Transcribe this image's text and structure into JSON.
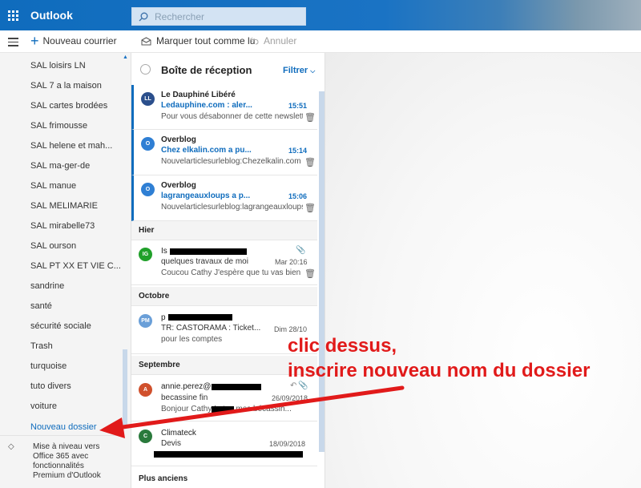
{
  "app": {
    "title": "Outlook"
  },
  "search": {
    "placeholder": "Rechercher"
  },
  "toolbar": {
    "new_mail_label": "Nouveau courrier",
    "mark_all_read_label": "Marquer tout comme lu",
    "undo_label": "Annuler"
  },
  "folders": {
    "items": [
      "SAL loisirs LN",
      "SAL 7 a la maison",
      "SAL cartes brodées",
      "SAL frimousse",
      "SAL helene et mah...",
      "SAL ma-ger-de",
      "SAL manue",
      "SAL MELIMARIE",
      "SAL mirabelle73",
      "SAL ourson",
      "SAL PT XX ET VIE C...",
      "sandrine",
      "santé",
      "sécurité sociale",
      "Trash",
      "turquoise",
      "tuto divers",
      "voiture"
    ],
    "new_folder_label": "Nouveau dossier",
    "upgrade_text": "Mise à niveau vers Office 365 avec fonctionnalités Premium d'Outlook"
  },
  "inbox": {
    "title": "Boîte de réception",
    "filter_label": "Filtrer",
    "messages": [
      {
        "initials": "LL",
        "color": "#2b4f8c",
        "sender": "Le Dauphiné Libéré",
        "subject": "Ledauphine.com : aler...",
        "date": "15:51",
        "preview": "Pour vous désabonner de cette newslett..."
      },
      {
        "initials": "O",
        "color": "#2f7fd4",
        "sender": "Overblog",
        "subject": "Chez elkalin.com a pu...",
        "date": "15:14",
        "preview": "Nouvelarticlesurleblog:Chezelkalin.com B..."
      },
      {
        "initials": "O",
        "color": "#2f7fd4",
        "sender": "Overblog",
        "subject": "lagrangeauxloups a p...",
        "date": "15:06",
        "preview": "Nouvelarticlesurleblog:lagrangeauxloups..."
      }
    ],
    "sections": {
      "hier": "Hier",
      "octobre": "Octobre",
      "septembre": "Septembre",
      "anciens": "Plus anciens"
    },
    "hier_msg": {
      "initials": "IG",
      "color": "#20a02a",
      "sender": "Is",
      "subject": "quelques travaux de moi",
      "date": "Mar 20:16",
      "preview": "Coucou Cathy J'espère que tu vas bien ?..."
    },
    "octobre_msg": {
      "initials": "PM",
      "color": "#6a9fd8",
      "sender": "p",
      "subject": "TR: CASTORAMA : Ticket...",
      "date": "Dim 28/10",
      "preview": "pour les comptes"
    },
    "sept_msg1": {
      "initials": "A",
      "color": "#d0502c",
      "sender": "annie.perez@",
      "subject": "becassine fin",
      "date": "26/09/2018",
      "preview": "Bonjour Cathy !      otos mes bécassin..."
    },
    "sept_msg2": {
      "initials": "C",
      "color": "#2a7a3c",
      "sender": "Climateck",
      "subject": "Devis",
      "date": "18/09/2018",
      "preview": ""
    }
  },
  "annotation": {
    "line1": "clic dessus,",
    "line2": "inscrire nouveau nom du dossier",
    "color": "#e11a1a"
  }
}
